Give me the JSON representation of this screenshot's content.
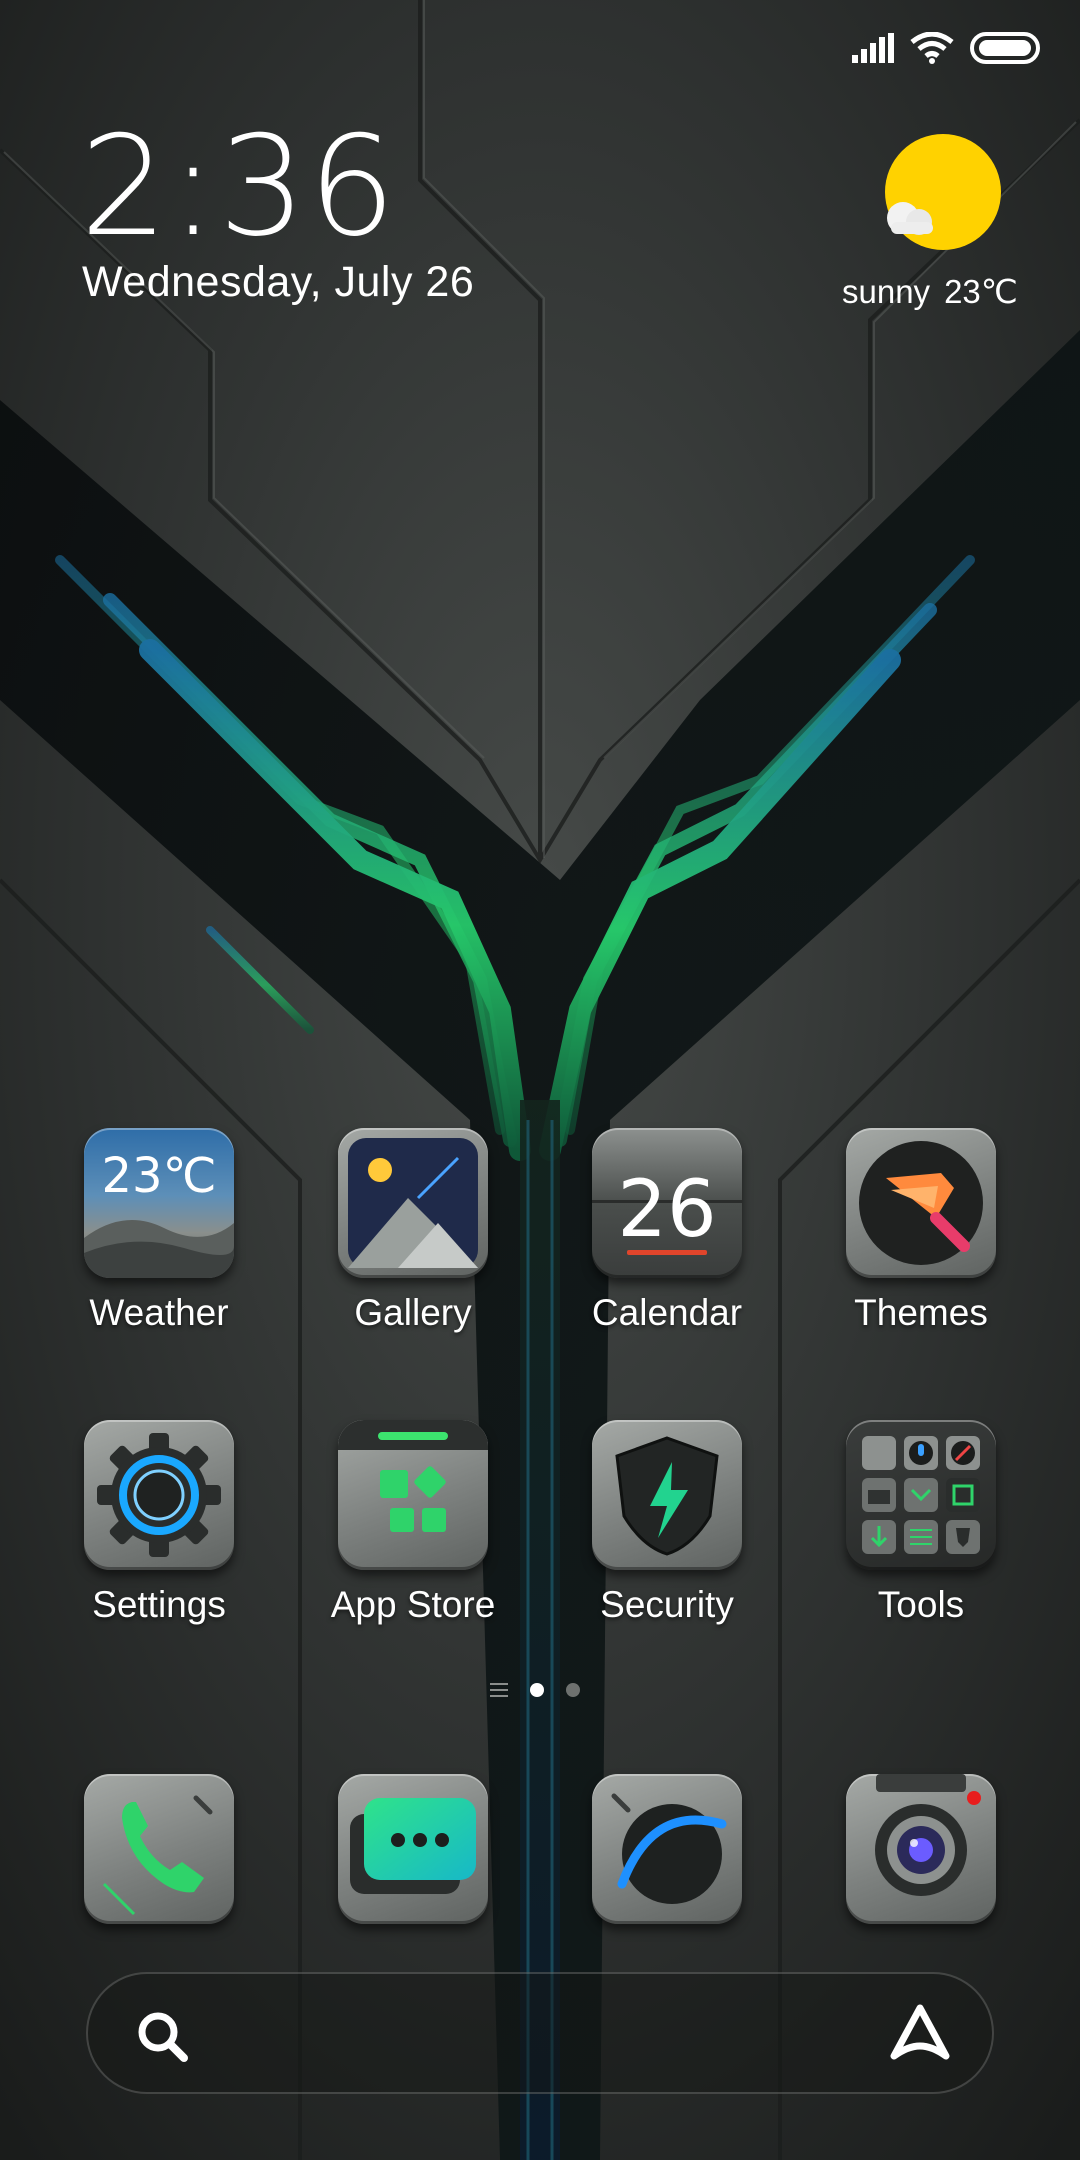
{
  "status_bar": {
    "icons": [
      "cellular-signal-icon",
      "wifi-icon",
      "battery-icon"
    ]
  },
  "clock_widget": {
    "time": "2:36",
    "date": "Wednesday, July 26"
  },
  "weather_widget": {
    "icon": "sun-cloud-icon",
    "condition": "sunny",
    "temperature": "23℃"
  },
  "apps": [
    {
      "label": "Weather",
      "icon": "weather-app-icon",
      "icon_text": "23℃"
    },
    {
      "label": "Gallery",
      "icon": "gallery-app-icon"
    },
    {
      "label": "Calendar",
      "icon": "calendar-app-icon",
      "icon_text": "26"
    },
    {
      "label": "Themes",
      "icon": "themes-app-icon"
    },
    {
      "label": "Settings",
      "icon": "settings-app-icon"
    },
    {
      "label": "App Store",
      "icon": "app-store-app-icon"
    },
    {
      "label": "Security",
      "icon": "security-app-icon"
    },
    {
      "label": "Tools",
      "icon": "tools-folder-icon"
    }
  ],
  "page_indicator": {
    "pages": 2,
    "current": 1
  },
  "dock": [
    {
      "icon": "phone-icon"
    },
    {
      "icon": "messages-icon"
    },
    {
      "icon": "browser-icon"
    },
    {
      "icon": "camera-icon"
    }
  ],
  "search_bar": {
    "left_icon": "search-icon",
    "right_icon": "assistant-icon"
  },
  "colors": {
    "accent_green": "#2fd36a",
    "sun_yellow": "#ffd200",
    "background": "#2b2d2c"
  }
}
